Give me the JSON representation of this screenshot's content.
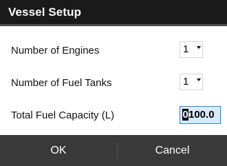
{
  "dialog": {
    "title": "Vessel Setup"
  },
  "rows": [
    {
      "label": "Number of Engines",
      "value": "1"
    },
    {
      "label": "Number of Fuel Tanks",
      "value": "1"
    }
  ],
  "capacity": {
    "label": "Total Fuel Capacity (L)",
    "cursor_digit": "0",
    "rest": "100.0"
  },
  "footer": {
    "ok_label": "OK",
    "cancel_label": "Cancel"
  },
  "colors": {
    "title_bar": "#1a1a1a",
    "footer": "#3a3a3a",
    "input_focus_border": "#1c86e3",
    "input_focus_fill": "#d9ebf8"
  }
}
